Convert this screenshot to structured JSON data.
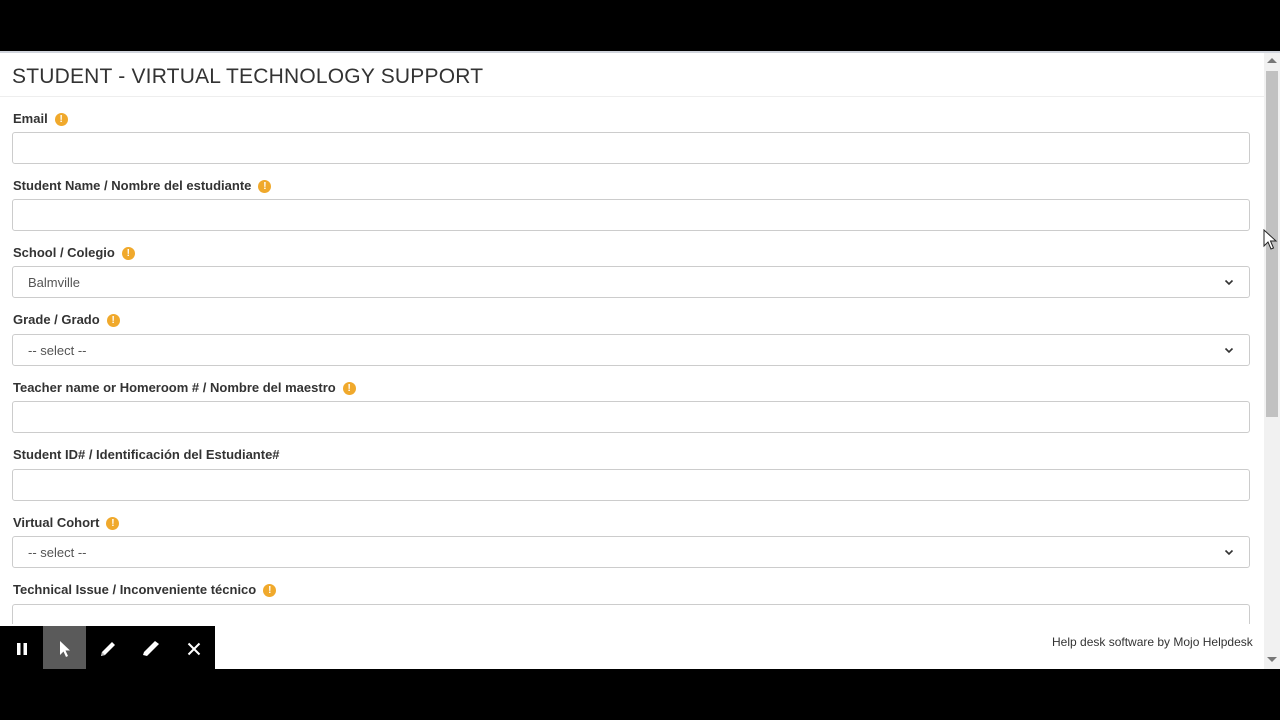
{
  "page": {
    "title": "STUDENT - VIRTUAL TECHNOLOGY SUPPORT",
    "footer": "Help desk software by Mojo Helpdesk"
  },
  "fields": {
    "email": {
      "label": "Email",
      "value": ""
    },
    "student_name": {
      "label": "Student Name / Nombre del estudiante",
      "value": ""
    },
    "school": {
      "label": "School / Colegio",
      "selected": "Balmville"
    },
    "grade": {
      "label": "Grade / Grado",
      "selected": "-- select --"
    },
    "teacher": {
      "label": "Teacher name or Homeroom # / Nombre del maestro",
      "value": ""
    },
    "student_id": {
      "label": "Student ID# / Identificación del Estudiante#",
      "value": ""
    },
    "virtual_cohort": {
      "label": "Virtual Cohort",
      "selected": "-- select --"
    },
    "technical_issue": {
      "label": "Technical Issue / Inconveniente técnico"
    }
  },
  "required_icon_glyph": "!",
  "icons": {
    "required": "exclamation-circle-icon",
    "toolbar": [
      "pause-icon",
      "pointer-icon",
      "pencil-icon",
      "highlighter-icon",
      "close-icon"
    ]
  },
  "colors": {
    "required_icon": "#f0a92c",
    "toolbar_active": "#5a5a5a"
  }
}
